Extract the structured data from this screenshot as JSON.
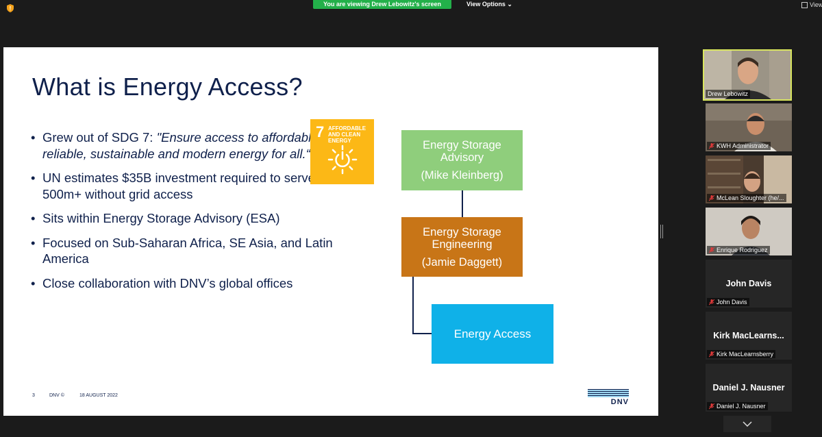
{
  "topbar": {
    "banner": "You are viewing Drew Lebowitz's screen",
    "view_options": "View Options",
    "view_right": "View"
  },
  "slide": {
    "title": "What is Energy Access?",
    "bullets": {
      "b1_plain": "Grew out of SDG 7: ",
      "b1_quote": "\"Ensure access to affordable, reliable, sustainable and modern energy for all.“",
      "b2": "UN estimates $35B investment required to serve the 500m+ without grid access",
      "b3": "Sits within Energy Storage Advisory (ESA)",
      "b4": "Focused on Sub-Saharan Africa, SE Asia, and Latin America",
      "b5": "Close collaboration with DNV’s global offices"
    },
    "sdg": {
      "number": "7",
      "text": "AFFORDABLE AND CLEAN ENERGY"
    },
    "org": {
      "box1_title": "Energy Storage Advisory",
      "box1_person": "(Mike Kleinberg)",
      "box2_title": "Energy Storage Engineering",
      "box2_person": "(Jamie Daggett)",
      "box3_title": "Energy Access"
    },
    "footer": {
      "page": "3",
      "brand": "DNV ©",
      "date": "18 AUGUST 2022",
      "logo_text": "DNV"
    }
  },
  "participants": [
    {
      "name": "Drew Lebowitz"
    },
    {
      "name": "KWH Administrator"
    },
    {
      "name": "McLean Sloughter (he/..."
    },
    {
      "name": "Enrique Rodriguez"
    },
    {
      "display": "John Davis",
      "name": "John Davis"
    },
    {
      "display": "Kirk  MacLearns...",
      "name": "Kirk MacLearnsberry"
    },
    {
      "display": "Daniel J. Nausner",
      "name": "Daniel J. Nausner"
    }
  ],
  "colors": {
    "banner": "#23b04a",
    "active_border": "#d9e65e",
    "navy": "#0f204b",
    "green": "#8fce7c",
    "orange": "#c87517",
    "cyan": "#0fb1e8",
    "sdg": "#fcb816"
  }
}
